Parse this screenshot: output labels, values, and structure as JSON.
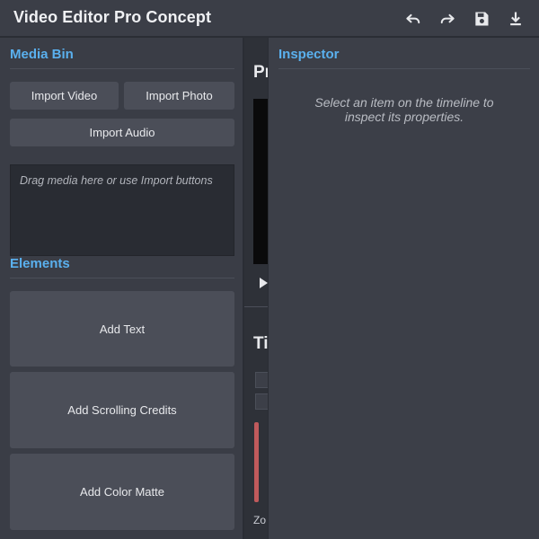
{
  "app": {
    "title": "Video Editor Pro Concept",
    "toolbar": {
      "undo_icon": "undo-icon",
      "redo_icon": "redo-icon",
      "save_icon": "save-icon",
      "download_icon": "download-icon"
    }
  },
  "media_bin": {
    "title": "Media Bin",
    "import_video": "Import Video",
    "import_photo": "Import Photo",
    "import_audio": "Import Audio",
    "dropzone_text": "Drag media here or use Import buttons"
  },
  "elements": {
    "title": "Elements",
    "add_text": "Add Text",
    "add_scrolling_credits": "Add Scrolling Credits",
    "add_color_matte": "Add Color Matte"
  },
  "middle": {
    "preview_heading_partial": "Pr",
    "timeline_heading_partial": "Ti",
    "zoom_label_partial": "Zo",
    "play_icon": "play-icon"
  },
  "inspector": {
    "title": "Inspector",
    "message_line1": "Select an item on the timeline to",
    "message_line2": "inspect its properties."
  },
  "colors": {
    "accent": "#5ab0ee",
    "panel": "#3a3d46",
    "button": "#4b4e58",
    "clip_red": "#c05a5c"
  }
}
